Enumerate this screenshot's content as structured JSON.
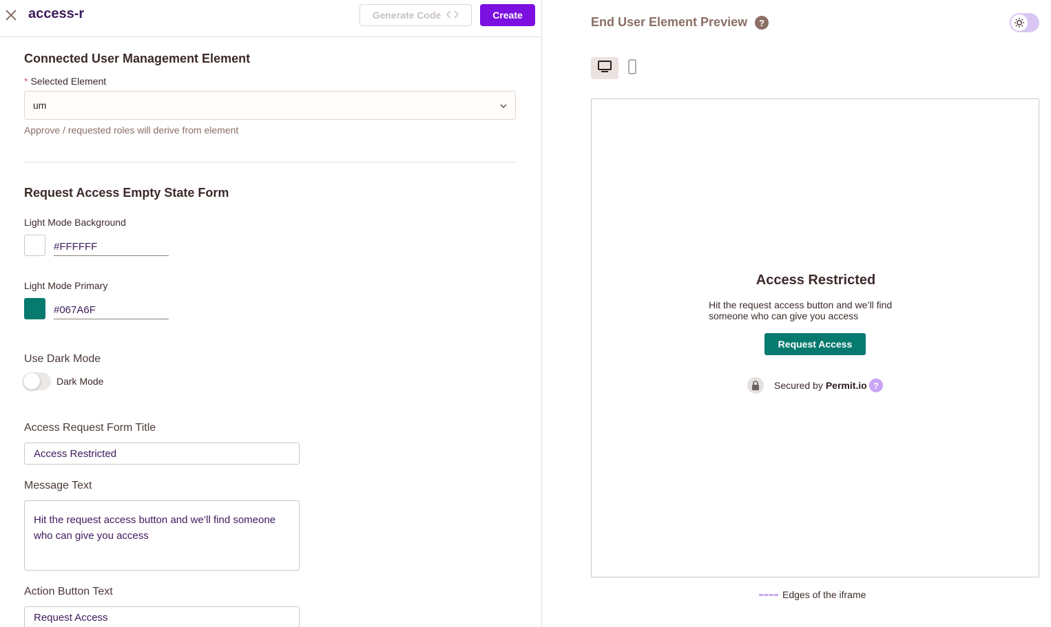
{
  "header": {
    "title": "access-r",
    "generate_code_label": "Generate Code",
    "create_label": "Create"
  },
  "connected": {
    "heading": "Connected User Management Element",
    "selected_label": "Selected Element",
    "selected_value": "um",
    "helper": "Approve / requested roles will derive from element"
  },
  "form": {
    "heading": "Request Access Empty State Form",
    "light_bg_label": "Light Mode Background",
    "light_bg_value": "#FFFFFF",
    "light_primary_label": "Light Mode Primary",
    "light_primary_value": "#067A6F",
    "dark_mode_heading": "Use Dark Mode",
    "dark_mode_toggle_label": "Dark Mode",
    "dark_mode_enabled": false,
    "title_label": "Access Request Form Title",
    "title_value": "Access Restricted",
    "message_label": "Message Text",
    "message_value": "Hit the request access button and we’ll find someone who can give you access",
    "button_label": "Action Button Text",
    "button_value": "Request Access"
  },
  "preview": {
    "heading": "End User Element Preview",
    "help_glyph": "?",
    "device_mode": "desktop",
    "title": "Access Restricted",
    "message": "Hit the request access button and we’ll find someone who can give you access",
    "button": "Request Access",
    "secured_by": "Secured by",
    "brand": "Permit.io",
    "brand_help": "?",
    "legend": "Edges of the iframe"
  },
  "colors": {
    "accent": "#7b10e0",
    "primary": "#067A6F",
    "background": "#FFFFFF"
  },
  "icons": [
    "close-icon",
    "code-icon",
    "chevron-down-icon",
    "help-icon",
    "sun-icon",
    "desktop-icon",
    "mobile-icon",
    "lock-icon"
  ]
}
